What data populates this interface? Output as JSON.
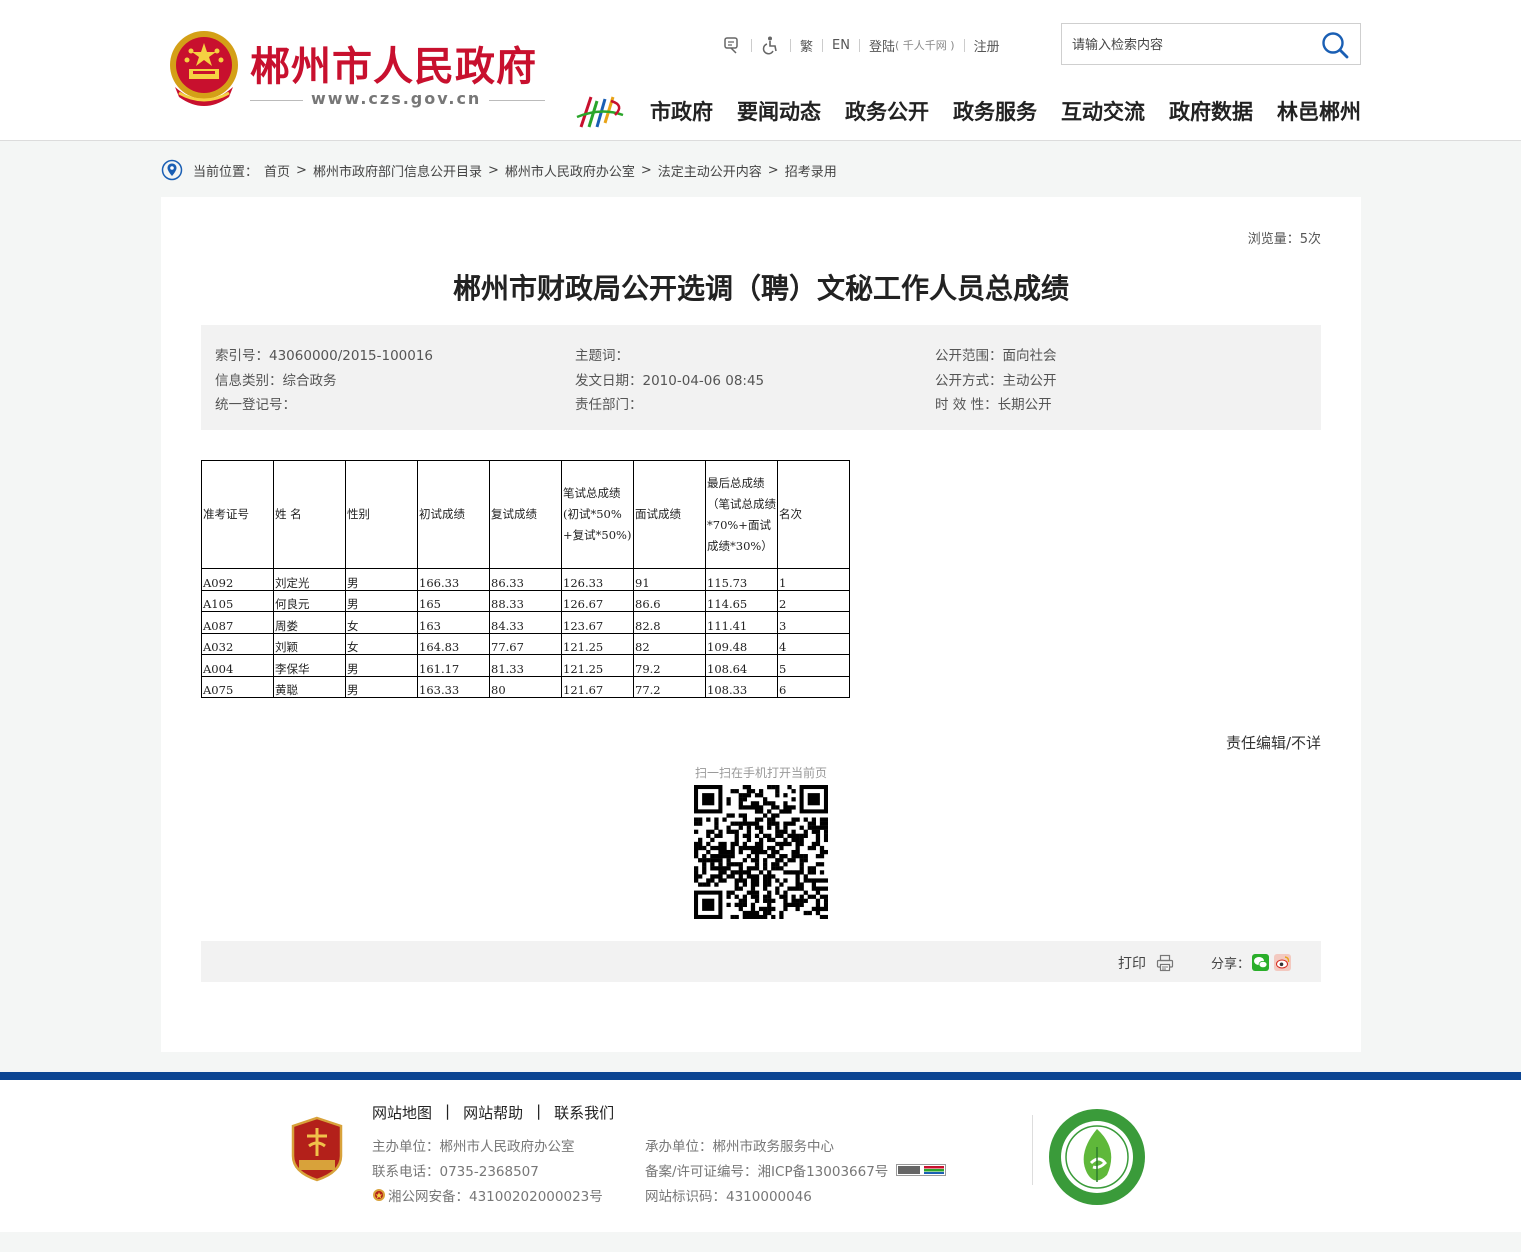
{
  "header": {
    "site_title": "郴州市人民政府",
    "site_url": "www.czs.gov.cn",
    "toplinks": {
      "traditional": "繁",
      "english": "EN",
      "login": "登陆",
      "login_note": "( 千人千网 )",
      "register": "注册"
    },
    "search": {
      "placeholder": "请输入检索内容"
    },
    "nav": [
      "市政府",
      "要闻动态",
      "政务公开",
      "政务服务",
      "互动交流",
      "政府数据",
      "林邑郴州"
    ]
  },
  "breadcrumb": {
    "label": "当前位置：",
    "items": [
      "首页",
      "郴州市政府部门信息公开目录",
      "郴州市人民政府办公室",
      "法定主动公开内容",
      "招考录用"
    ],
    "separator": ">"
  },
  "article": {
    "views": "浏览量：5次",
    "title": "郴州市财政局公开选调（聘）文秘工作人员总成绩",
    "meta": {
      "index_no": "索引号：43060000/2015-100016",
      "subject": "主题词：",
      "scope": "公开范围：面向社会",
      "category": "信息类别：综合政务",
      "date": "发文日期：2010-04-06 08:45",
      "method": "公开方式：主动公开",
      "reg_no": "统一登记号：",
      "dept": "责任部门：",
      "validity": "时 效 性：长期公开"
    },
    "table": {
      "headers": [
        "准考证号",
        "姓 名",
        "性别",
        "初试成绩",
        "复试成绩",
        "笔试总成绩(初试*50%+复试*50%)",
        "面试成绩",
        "最后总成绩（笔试总成绩*70%+面试成绩*30%）",
        "名次"
      ],
      "rows": [
        [
          "A092",
          "刘定光",
          "男",
          "166.33",
          "86.33",
          "126.33",
          "91",
          "115.73",
          "1"
        ],
        [
          "A105",
          "何良元",
          "男",
          "165",
          "88.33",
          "126.67",
          "86.6",
          "114.65",
          "2"
        ],
        [
          "A087",
          "周娄",
          "女",
          "163",
          "84.33",
          "123.67",
          "82.8",
          "111.41",
          "3"
        ],
        [
          "A032",
          "刘颖",
          "女",
          "164.83",
          "77.67",
          "121.25",
          "82",
          "109.48",
          "4"
        ],
        [
          "A004",
          "李保华",
          "男",
          "161.17",
          "81.33",
          "121.25",
          "79.2",
          "108.64",
          "5"
        ],
        [
          "A075",
          "黄聪",
          "男",
          "163.33",
          "80",
          "121.67",
          "77.2",
          "108.33",
          "6"
        ]
      ]
    },
    "editor": "责任编辑/不详",
    "qr_caption": "扫一扫在手机打开当前页",
    "print_label": "打印",
    "share_label": "分享："
  },
  "footer": {
    "links": [
      "网站地图",
      "网站帮助",
      "联系我们"
    ],
    "link_sep": "|",
    "host": "主办单位：郴州市人民政府办公室",
    "organizer": "承办单位：郴州市政务服务中心",
    "phone": "联系电话：0735-2368507",
    "icp": "备案/许可证编号：湘ICP备13003667号",
    "police": "湘公网安备：43100202000023号",
    "site_code": "网站标识码：4310000046"
  },
  "colors": {
    "brand_red": "#c8102e",
    "footer_blue": "#0c4592",
    "wechat_green": "#2aae2a"
  }
}
